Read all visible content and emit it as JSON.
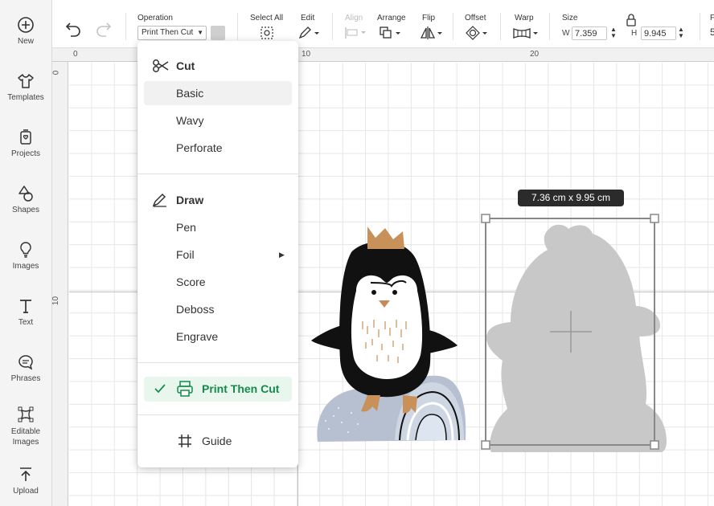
{
  "sidebar": {
    "items": [
      {
        "label": "New",
        "icon": "plus-circle-icon"
      },
      {
        "label": "Templates",
        "icon": "shirt-icon"
      },
      {
        "label": "Projects",
        "icon": "projects-icon"
      },
      {
        "label": "Shapes",
        "icon": "shapes-icon"
      },
      {
        "label": "Images",
        "icon": "lightbulb-icon"
      },
      {
        "label": "Text",
        "icon": "text-icon"
      },
      {
        "label": "Phrases",
        "icon": "speech-bubble-icon"
      },
      {
        "label": "Editable Images",
        "label_line1": "Editable",
        "label_line2": "Images",
        "icon": "editable-images-icon"
      },
      {
        "label": "Upload",
        "icon": "upload-icon"
      }
    ]
  },
  "toolbar": {
    "operation_label": "Operation",
    "operation_value": "Print Then Cut",
    "select_all": "Select All",
    "edit": "Edit",
    "align": "Align",
    "arrange": "Arrange",
    "flip": "Flip",
    "offset": "Offset",
    "warp": "Warp",
    "size_label": "Size",
    "width_prefix": "W",
    "width_value": "7.359",
    "height_prefix": "H",
    "height_value": "9.945",
    "overflow_label": "F",
    "overflow_value": "5"
  },
  "ruler": {
    "top": [
      "0",
      "10",
      "20"
    ],
    "left": [
      "0",
      "10"
    ]
  },
  "selection": {
    "dimension_tag": "7.36  cm x 9.95  cm"
  },
  "menu": {
    "cut_header": "Cut",
    "cut_items": [
      "Basic",
      "Wavy",
      "Perforate"
    ],
    "draw_header": "Draw",
    "draw_items": [
      "Pen",
      "Foil",
      "Score",
      "Deboss",
      "Engrave"
    ],
    "print_then_cut": "Print Then Cut",
    "guide": "Guide"
  },
  "colors": {
    "accent_green": "#148a4b",
    "shadow_gray": "#c8c8c8"
  }
}
